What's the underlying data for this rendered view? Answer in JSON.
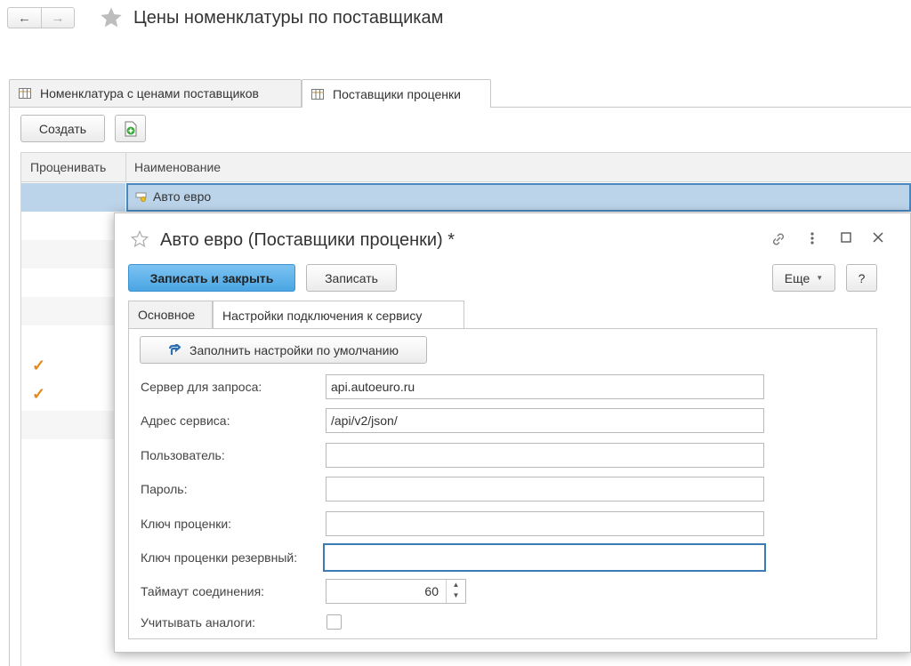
{
  "header": {
    "back_glyph": "←",
    "forward_glyph": "→",
    "title": "Цены номенклатуры по поставщикам"
  },
  "tabs": [
    {
      "label": "Номенклатура с ценами поставщиков",
      "icon": "table-icon",
      "active": false
    },
    {
      "label": "Поставщики проценки",
      "icon": "table-icon",
      "active": true
    }
  ],
  "toolbar": {
    "create_label": "Создать",
    "add_icon": "add-document-icon"
  },
  "list": {
    "columns": [
      "Проценивать",
      "Наименование"
    ],
    "selected_row": {
      "name": "Авто евро"
    },
    "check_glyph": "✓"
  },
  "dialog": {
    "title": "Авто евро (Поставщики проценки) *",
    "save_close_label": "Записать и закрыть",
    "save_label": "Записать",
    "more_label": "Еще",
    "help_label": "?",
    "tabs": [
      "Основное",
      "Настройки подключения к сервису"
    ],
    "fill_defaults_label": "Заполнить настройки по умолчанию",
    "fields": {
      "server_label": "Сервер для запроса:",
      "server_value": "api.autoeuro.ru",
      "address_label": "Адрес сервиса:",
      "address_value": "/api/v2/json/",
      "user_label": "Пользователь:",
      "user_value": "",
      "password_label": "Пароль:",
      "password_value": "",
      "key_label": "Ключ проценки:",
      "key_value": "",
      "key_reserve_label": "Ключ проценки резервный:",
      "key_reserve_value": "",
      "timeout_label": "Таймаут соединения:",
      "timeout_value": "60",
      "analogs_label": "Учитывать аналоги:",
      "analogs_checked": false
    }
  },
  "colors": {
    "accent": "#4aa6e3",
    "selection": "#bcd4ea",
    "check": "#e48a1a"
  }
}
